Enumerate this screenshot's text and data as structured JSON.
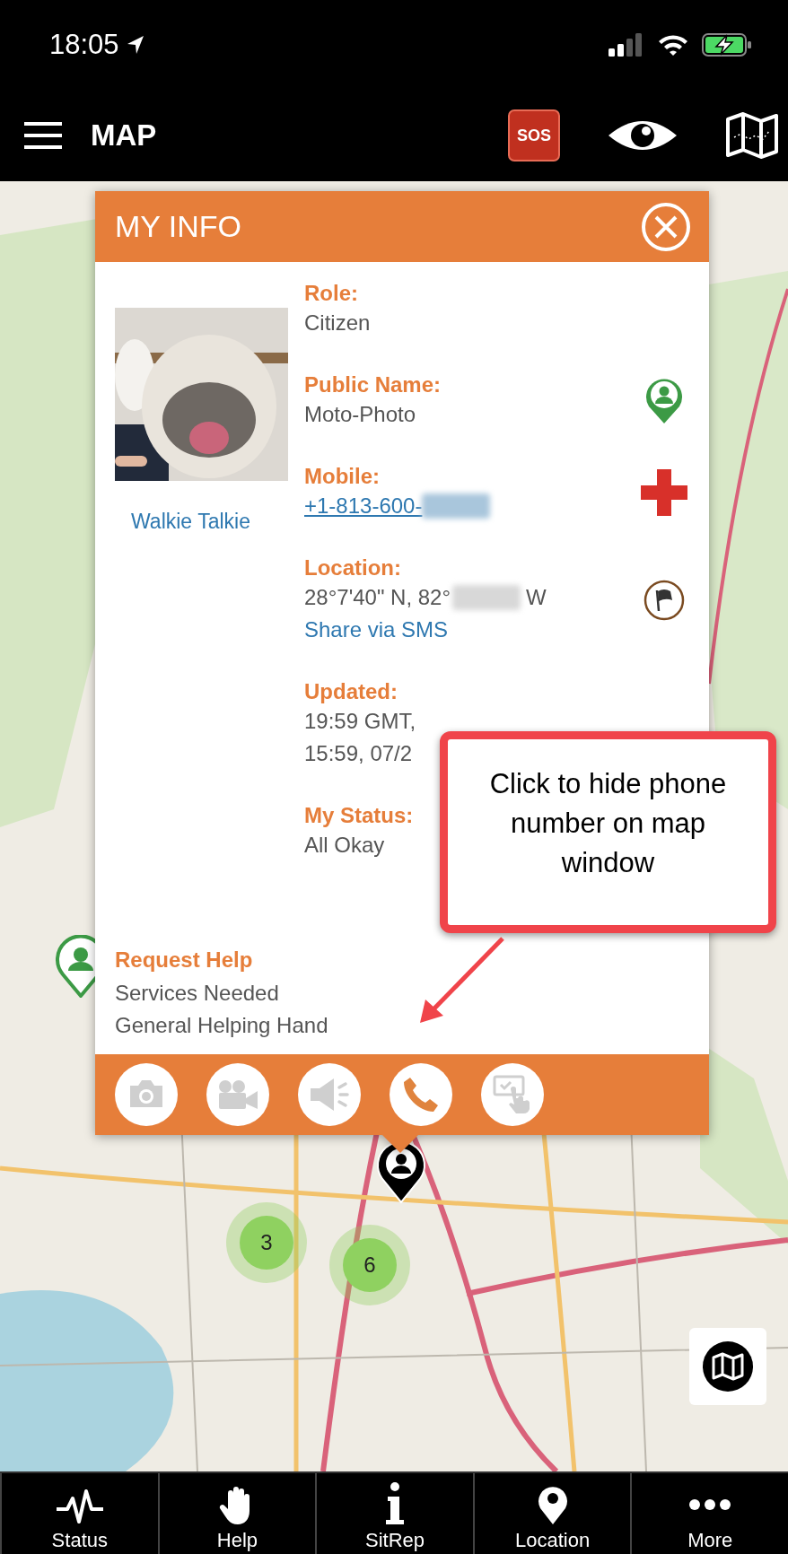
{
  "status_bar": {
    "time": "18:05"
  },
  "header": {
    "title": "MAP",
    "sos_label": "SOS"
  },
  "map": {
    "clusters": [
      {
        "count": "3"
      },
      {
        "count": "6"
      }
    ]
  },
  "info_card": {
    "title": "MY INFO",
    "photo_caption": "Walkie Talkie",
    "fields": [
      {
        "label": "Role:",
        "kind": "none",
        "lines": [
          {
            "kind": "plain",
            "text": "Citizen"
          }
        ]
      },
      {
        "label": "Public Name:",
        "kind": "person-pin",
        "lines": [
          {
            "kind": "plain",
            "text": "Moto-Photo"
          }
        ]
      },
      {
        "label": "Mobile:",
        "kind": "cross",
        "lines": [
          {
            "kind": "phone",
            "text": "+1-813-600-"
          }
        ]
      },
      {
        "label": "Location:",
        "kind": "flag",
        "lines": [
          {
            "kind": "masked",
            "text": "28°7'40\" N, 82°",
            "after": "W"
          },
          {
            "kind": "link",
            "text": "Share via SMS"
          }
        ]
      },
      {
        "label": "Updated:",
        "kind": "none",
        "lines": [
          {
            "kind": "plain",
            "text": "19:59 GMT,"
          },
          {
            "kind": "plain",
            "text": "15:59, 07/2"
          }
        ]
      },
      {
        "label": "My Status:",
        "kind": "none",
        "lines": [
          {
            "kind": "plain",
            "text": "All Okay"
          }
        ]
      }
    ],
    "request_help": {
      "title": "Request Help",
      "lines": [
        "Services Needed",
        "General Helping Hand"
      ]
    },
    "actions": [
      {
        "kind": "camera",
        "active": false
      },
      {
        "kind": "video",
        "active": false
      },
      {
        "kind": "megaphone",
        "active": false
      },
      {
        "kind": "phone",
        "active": true
      },
      {
        "kind": "touch",
        "active": false
      }
    ]
  },
  "callout": {
    "text": "Click to hide phone number on map window"
  },
  "tabs": [
    {
      "kind": "pulse",
      "label": "Status"
    },
    {
      "kind": "hand",
      "label": "Help"
    },
    {
      "kind": "info",
      "label": "SitRep"
    },
    {
      "kind": "pin",
      "label": "Location"
    },
    {
      "kind": "dots",
      "label": "More"
    }
  ]
}
